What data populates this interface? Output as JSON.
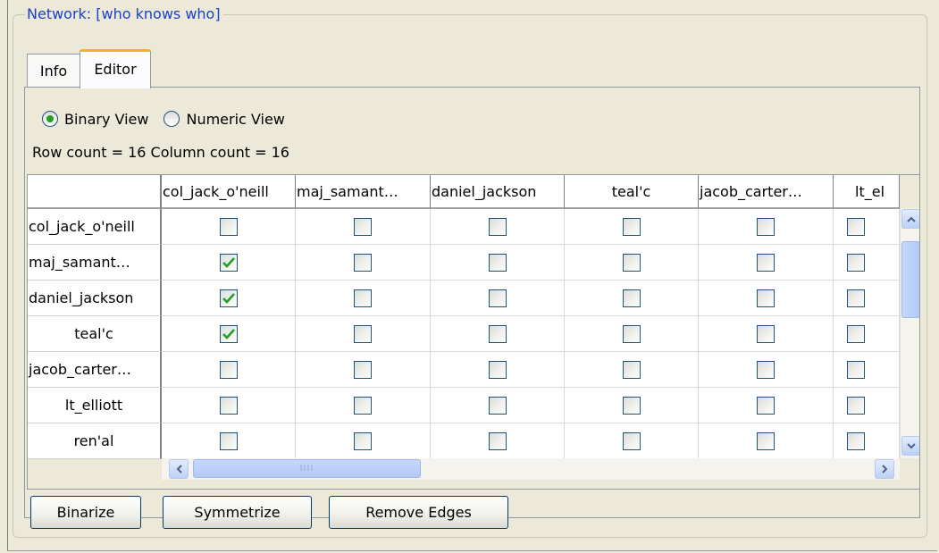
{
  "network": {
    "title": "Network: [who knows who]"
  },
  "tabs": [
    {
      "label": "Info"
    },
    {
      "label": "Editor"
    }
  ],
  "view": {
    "binary_label": "Binary View",
    "numeric_label": "Numeric View",
    "selected": "Binary View"
  },
  "counts": {
    "text": "Row count = 16 Column count = 16"
  },
  "matrix": {
    "columns": [
      "col_jack_o'neill",
      "maj_samant…",
      "daniel_jackson",
      "teal'c",
      "jacob_carter…",
      "lt_el"
    ],
    "rows": [
      {
        "label": "col_jack_o'neill",
        "checked": [
          false,
          false,
          false,
          false,
          false,
          false
        ]
      },
      {
        "label": "maj_samant…",
        "checked": [
          true,
          false,
          false,
          false,
          false,
          false
        ]
      },
      {
        "label": "daniel_jackson",
        "checked": [
          true,
          false,
          false,
          false,
          false,
          false
        ]
      },
      {
        "label": "teal'c",
        "checked": [
          true,
          false,
          false,
          false,
          false,
          false
        ]
      },
      {
        "label": "jacob_carter…",
        "checked": [
          false,
          false,
          false,
          false,
          false,
          false
        ]
      },
      {
        "label": "lt_elliott",
        "checked": [
          false,
          false,
          false,
          false,
          false,
          false
        ]
      },
      {
        "label": "ren'al",
        "checked": [
          false,
          false,
          false,
          false,
          false,
          false
        ]
      }
    ]
  },
  "buttons": {
    "binarize": "Binarize",
    "symmetrize": "Symmetrize",
    "remove_edges": "Remove Edges"
  },
  "colors": {
    "legend": "#1a40c8",
    "check": "#21a121",
    "tab_highlight": "#f0b035"
  }
}
